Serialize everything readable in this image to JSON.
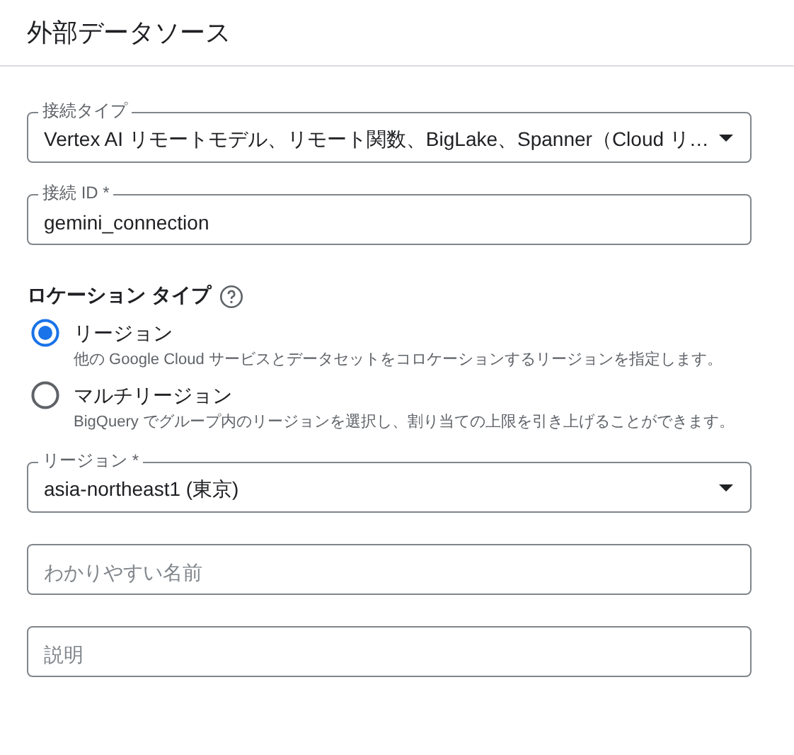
{
  "header": {
    "title": "外部データソース"
  },
  "top_fields": [
    {
      "kind": "select",
      "label": "接続タイプ",
      "value": "Vertex AI リモートモデル、リモート関数、BigLake、Spanner（Cloud リ…"
    },
    {
      "kind": "text",
      "label": "接続 ID *",
      "value": "gemini_connection"
    }
  ],
  "location_type": {
    "label": "ロケーション タイプ",
    "options": [
      {
        "label": "リージョン",
        "description": "他の Google Cloud サービスとデータセットをコロケーションするリージョンを指定します。",
        "selected": true
      },
      {
        "label": "マルチリージョン",
        "description": "BigQuery でグループ内のリージョンを選択し、割り当ての上限を引き上げることができます。",
        "selected": false
      }
    ]
  },
  "bottom_fields": [
    {
      "kind": "select",
      "label": "リージョン *",
      "value": "asia-northeast1 (東京)"
    },
    {
      "kind": "text",
      "placeholder": "わかりやすい名前"
    },
    {
      "kind": "text",
      "placeholder": "説明"
    }
  ]
}
